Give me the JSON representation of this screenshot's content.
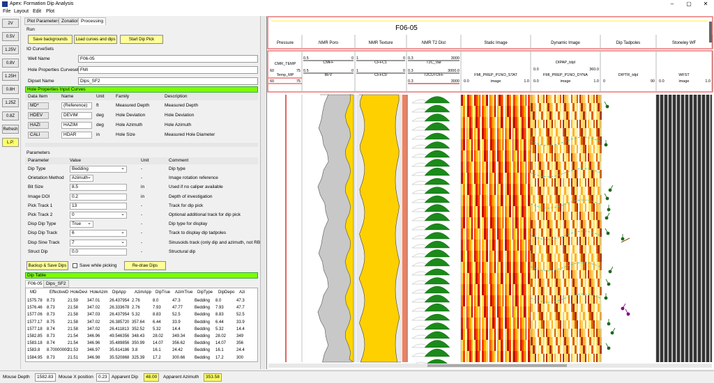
{
  "window": {
    "title": "Apex: Formation Dip Analysis"
  },
  "menu": [
    "File",
    "Layout",
    "Edit",
    "Plot"
  ],
  "toolbar": [
    "2V",
    "0.5V",
    "1.25V",
    "0.8V",
    "1.25H",
    "0.8H",
    "1.25Z",
    "0.8Z",
    "Refresh",
    "L.P."
  ],
  "tabs": [
    "Plot Parameters",
    "Zonation",
    "Processing"
  ],
  "run": {
    "title": "Run",
    "save_backgrounds": "Save backgrounds",
    "load_curves": "Load curves and dips",
    "start_dip_pick": "Start Dip Pick"
  },
  "io": {
    "title": "IO CurveSets",
    "well_name_label": "Well Name",
    "well_name": "F06-05",
    "hole_props_label": "Hole Properties Curveset",
    "hole_props": "FMI",
    "dipset_label": "Dipset Name",
    "dipset": "Dips_SF2"
  },
  "hole_curves": {
    "title": "Hole Properties Input Curves",
    "headers": [
      "Data Item",
      "Name",
      "Unit",
      "Family",
      "Description"
    ],
    "rows": [
      [
        "MD*",
        "(Reference)",
        "ft",
        "Measured Depth",
        "Measured Depth"
      ],
      [
        "HDEV",
        "DEVIM",
        "deg",
        "Hole Deviation",
        "Hole Deviation"
      ],
      [
        "HAZI",
        "HAZIM",
        "deg",
        "Hole Azimuth",
        "Hole Azimuth"
      ],
      [
        "CALI",
        "HDAR",
        "in",
        "Hole Size",
        "Measured Hole Diameter"
      ]
    ]
  },
  "params": {
    "title": "Parameters",
    "headers": [
      "Parameter",
      "Value",
      "Unit",
      "Comment"
    ],
    "rows": [
      [
        "Dip Type",
        "Bedding",
        "-",
        "Dip type"
      ],
      [
        "Orietation Method",
        "Azimuth",
        "-",
        "Image rotation reference"
      ],
      [
        "Bit Size",
        "8.5",
        "in",
        "Used if no caliper available"
      ],
      [
        "Image DOI",
        "0.2",
        "in",
        "Depth of investigation"
      ],
      [
        "Pick Track 1",
        "13",
        "-",
        "Track for dip pick"
      ],
      [
        "Pick Track 2",
        "0",
        "-",
        "Optional additional track for dip pick"
      ],
      [
        "Disp Dip Type",
        "True",
        "-",
        "Dip type for display"
      ],
      [
        "Disp Dip Track",
        "6",
        "-",
        "Track to display dip tadpoles"
      ],
      [
        "Disp Sine Track",
        "7",
        "-",
        "Sinusoids track (only dip and azimuth, not RB)"
      ],
      [
        "Struct Dip",
        "0.0",
        "-",
        "Structural dip"
      ]
    ]
  },
  "actions": {
    "backup": "Backup & Save Dips",
    "save_while_picking": "Save while picking",
    "redraw": "Re-draw Dips"
  },
  "dip_table": {
    "title": "Dip Table",
    "tabs": [
      "F06-05",
      "Dips_SF2"
    ],
    "headers": [
      "MD",
      "EffectiveD",
      "HoleDevi",
      "HoleAzim",
      "DipApp",
      "AzimApp",
      "DipTrue",
      "AzimTrue",
      "DipType",
      "DipDepo",
      "Azi"
    ],
    "rows": [
      [
        "1575.78",
        "8.73",
        "21.59",
        "347.01",
        "26.437954",
        "2.76",
        "8.0",
        "47.3",
        "Bedding",
        "8.0",
        "47.3"
      ],
      [
        "1576.46",
        "8.73",
        "21.58",
        "347.02",
        "26.333678",
        "2.76",
        "7.93",
        "47.77",
        "Bedding",
        "7.93",
        "47.7"
      ],
      [
        "1577.06",
        "8.73",
        "21.58",
        "347.03",
        "26.437954",
        "5.32",
        "8.83",
        "52.5",
        "Bedding",
        "8.83",
        "52.5"
      ],
      [
        "1577.17",
        "8.75",
        "21.58",
        "347.02",
        "26.385720",
        "357.64",
        "6.44",
        "33.9",
        "Bedding",
        "6.44",
        "33.9"
      ],
      [
        "1577.18",
        "8.74",
        "21.58",
        "347.02",
        "26.411813",
        "352.52",
        "5.32",
        "14.4",
        "Bedding",
        "5.32",
        "14.4"
      ],
      [
        "1582.85",
        "8.73",
        "21.54",
        "346.96",
        "49.546356",
        "348.43",
        "28.02",
        "349.34",
        "Bedding",
        "28.02",
        "349"
      ],
      [
        "1583.18",
        "8.74",
        "21.54",
        "346.96",
        "35.489856",
        "350.99",
        "14.07",
        "356.62",
        "Bedding",
        "14.07",
        "356"
      ],
      [
        "1583.8",
        "8.70000000",
        "21.53",
        "346.97",
        "35.614186",
        "3.8",
        "16.1",
        "24.42",
        "Bedding",
        "16.1",
        "24.4"
      ],
      [
        "1584.95",
        "8.73",
        "21.51",
        "346.98",
        "35.520868",
        "325.39",
        "17.2",
        "300.66",
        "Bedding",
        "17.2",
        "300"
      ]
    ]
  },
  "plot": {
    "well_title": "F06-05",
    "tracks": [
      "Pressure",
      "NMR Poro",
      "NMR Texture",
      "NMR T2 Dist",
      "Static Image",
      "Dynamic Image",
      "Dip Tadpoles",
      "Stoneley WF"
    ],
    "curves": {
      "p1": "CMR_TEMP",
      "p1a": "60",
      "p1b": "75",
      "p2": "Temp_MP",
      "p2a": "60",
      "p2b": "75",
      "n1": "CMFF",
      "n1a": "0.5",
      "n1b": "0",
      "n2": "BFV",
      "n2a": "0.5",
      "n2b": "0",
      "t1": "CFFC1",
      "t1a": "1",
      "t1b": "0",
      "t2": "CFFC0",
      "t2a": "1",
      "t2b": "0",
      "d1": "T2C_Var",
      "d1a": "0.3",
      "d1b": "3000",
      "d2": "T2CUTOFF",
      "d2a": "0.3",
      "d2b": "3000.0",
      "d3a": "0.3",
      "d3b": "3000",
      "s1": "FMI_PREP_P1NO_STAT",
      "s1a": "0.0",
      "s1m": "image",
      "s1b": "1.0",
      "y1": "DIPAP_tdpl",
      "y1a": "0.0",
      "y1b": "360.0",
      "y2": "FMI_PREP_P1NO_DYNA",
      "y2a": "0.0",
      "y2m": "image",
      "y2b": "1.0",
      "dt": "DIPTR_tdpl",
      "dta": "0",
      "dtb": "90",
      "w": "WFST",
      "wa": "0.0",
      "wm": "image",
      "wb": "1.0"
    }
  },
  "status": {
    "mouse_depth_label": "Mouse Depth",
    "mouse_depth": "1582.83",
    "mouse_x_label": "Mouse X position",
    "mouse_x": "0.23",
    "apparent_dip_label": "Apparent Dip",
    "apparent_dip": "48.00",
    "apparent_azimuth_label": "Apparent Azimuth",
    "apparent_azimuth": "353.58"
  },
  "colors": {
    "accent_green": "#7cfc00",
    "button_yellow": "#ffff99",
    "plot_border": "#e03030"
  }
}
